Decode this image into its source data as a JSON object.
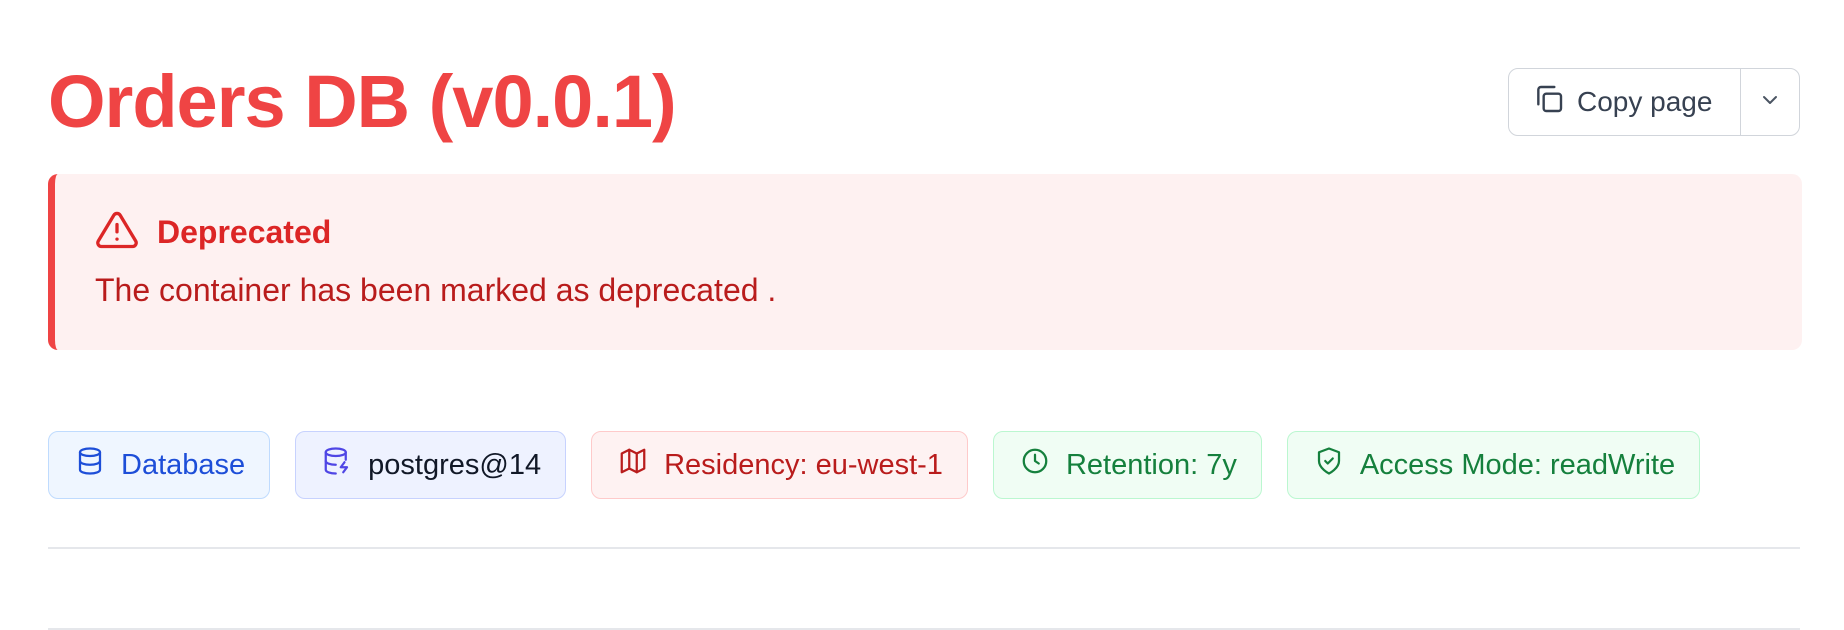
{
  "page": {
    "title": "Orders DB (v0.0.1)"
  },
  "copy_page": {
    "label": "Copy page",
    "icon": "copy-icon",
    "dropdown_icon": "chevron-down-icon"
  },
  "alert": {
    "icon": "warning-triangle-icon",
    "title": "Deprecated",
    "message": "The container has been marked as deprecated ."
  },
  "badges": [
    {
      "label": "Database",
      "icon": "database-icon",
      "color": "#1d4ed8"
    },
    {
      "label": "postgres@14",
      "icon": "database-zap-icon",
      "color": "#4f46e5"
    },
    {
      "label": "Residency: eu-west-1",
      "icon": "map-icon",
      "color": "#b91c1c"
    },
    {
      "label": "Retention: 7y",
      "icon": "clock-icon",
      "color": "#15803d"
    },
    {
      "label": "Access Mode: readWrite",
      "icon": "shield-check-icon",
      "color": "#15803d"
    }
  ],
  "colors": {
    "title": "#ef4444",
    "alert_bg": "#fef1f1",
    "alert_border": "#ef4444"
  }
}
